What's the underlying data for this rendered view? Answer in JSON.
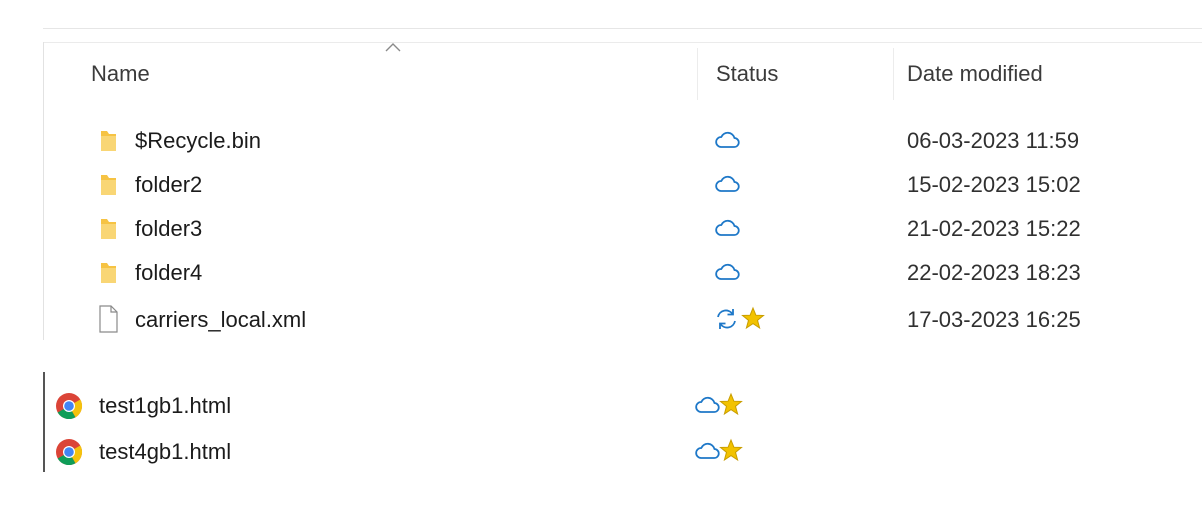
{
  "header": {
    "name_label": "Name",
    "status_label": "Status",
    "date_label": "Date modified",
    "sort": "ascending"
  },
  "files": [
    {
      "name": "$Recycle.bin",
      "type": "folder",
      "status": "cloud",
      "date": "06-03-2023 11:59"
    },
    {
      "name": "folder2",
      "type": "folder",
      "status": "cloud",
      "date": "15-02-2023 15:02"
    },
    {
      "name": "folder3",
      "type": "folder",
      "status": "cloud",
      "date": "21-02-2023 15:22"
    },
    {
      "name": "folder4",
      "type": "folder",
      "status": "cloud",
      "date": "22-02-2023 18:23"
    },
    {
      "name": "carriers_local.xml",
      "type": "file",
      "status": "sync-pending, pinned",
      "date": "17-03-2023 16:25"
    }
  ],
  "lower_files": [
    {
      "name": "test1gb1.html",
      "type": "chrome-html",
      "status": "cloud, pinned"
    },
    {
      "name": "test4gb1.html",
      "type": "chrome-html",
      "status": "cloud, pinned"
    }
  ],
  "colors": {
    "cloud": "#1e78c8",
    "star": "#f2c200",
    "folder": "#f6c343"
  }
}
